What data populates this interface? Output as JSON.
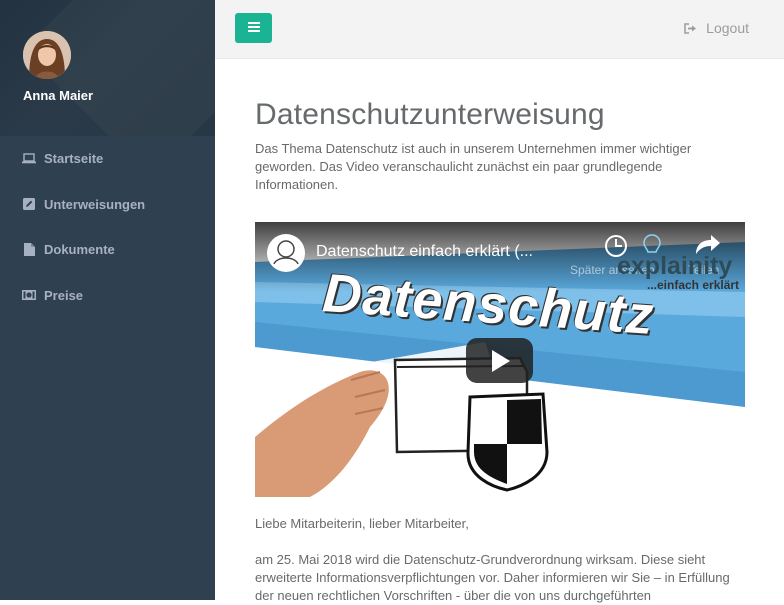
{
  "user": {
    "name": "Anna Maier"
  },
  "sidebar": {
    "items": [
      {
        "label": "Startseite",
        "icon": "laptop-icon"
      },
      {
        "label": "Unterweisungen",
        "icon": "edit-icon"
      },
      {
        "label": "Dokumente",
        "icon": "file-icon"
      },
      {
        "label": "Preise",
        "icon": "money-icon"
      }
    ]
  },
  "topbar": {
    "logout_label": "Logout",
    "menu_icon": "hamburger-icon"
  },
  "colors": {
    "sidebar": "#2f4050",
    "accent": "#1ab394",
    "topbar": "#f3f3f4",
    "text": "#676a6c"
  },
  "page": {
    "title": "Datenschutzunterweisung",
    "intro": "Das Thema Datenschutz ist auch in unserem Unternehmen immer wichtiger geworden. Das Video veranschaulicht zunächst ein paar grundlegende Informationen.",
    "greeting": "Liebe Mitarbeiterin, lieber Mitarbeiter,",
    "body": "am 25. Mai 2018 wird die Datenschutz-Grundverordnung wirksam. Diese sieht erweiterte Informationsverpflichtungen vor. Daher informieren wir Sie – in Erfüllung der neuen rechtlichen Vorschriften - über die von uns durchgeführten"
  },
  "video": {
    "title": "Datenschutz einfach erklärt (...",
    "watch_later": "Später ansehen",
    "share": "Teilen",
    "brand": "explainity",
    "brand_tagline": "...einfach erklärt",
    "thumbnail_text": "Datenschutz"
  }
}
